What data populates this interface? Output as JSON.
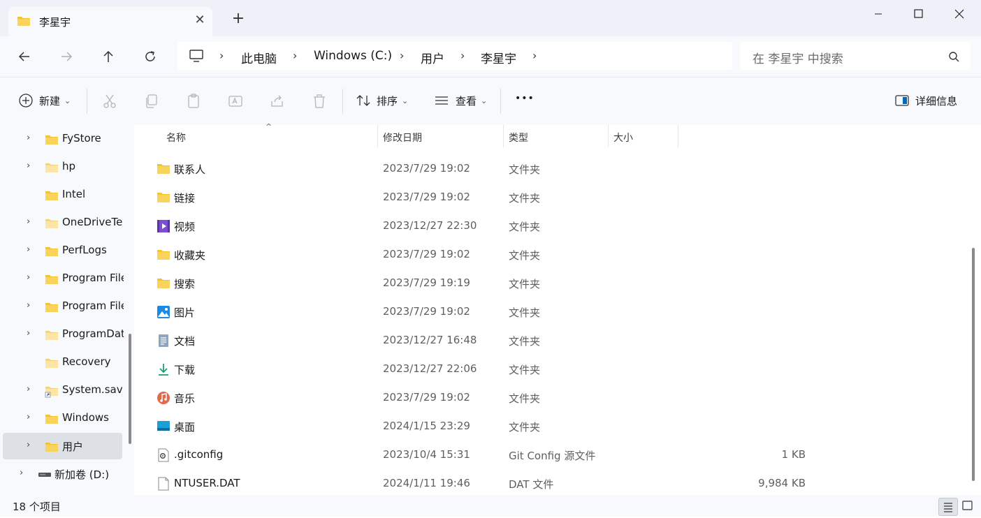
{
  "window": {
    "tab_title": "李星宇",
    "tab_close": "✕",
    "new_tab": "+",
    "minimize": "─",
    "close": "✕"
  },
  "address": {
    "crumbs": [
      "此电脑",
      "Windows (C:)",
      "用户",
      "李星宇"
    ],
    "separator": "›",
    "search_placeholder": "在 李星宇 中搜索"
  },
  "toolbar": {
    "new_label": "新建",
    "sort_label": "排序",
    "view_label": "查看",
    "more_label": "•••",
    "details_label": "详细信息",
    "dropdown_caret": "⌄"
  },
  "sidebar": {
    "items": [
      {
        "label": "FyStore",
        "chevron": "›"
      },
      {
        "label": "hp",
        "chevron": "›"
      },
      {
        "label": "Intel",
        "chevron": ""
      },
      {
        "label": "OneDriveTe",
        "chevron": "›"
      },
      {
        "label": "PerfLogs",
        "chevron": "›"
      },
      {
        "label": "Program File",
        "chevron": "›"
      },
      {
        "label": "Program File",
        "chevron": "›"
      },
      {
        "label": "ProgramDat",
        "chevron": "›"
      },
      {
        "label": "Recovery",
        "chevron": ""
      },
      {
        "label": "System.sav",
        "chevron": "›"
      },
      {
        "label": "Windows",
        "chevron": "›"
      },
      {
        "label": "用户",
        "chevron": "›"
      },
      {
        "label": "新加卷 (D:)",
        "chevron": "›"
      }
    ]
  },
  "table": {
    "sort_indicator": "^",
    "headers": {
      "name": "名称",
      "date": "修改日期",
      "type": "类型",
      "size": "大小"
    },
    "rows": [
      {
        "name": "联系人",
        "date": "2023/7/29 19:02",
        "type": "文件夹",
        "size": "",
        "icon": "folder-icon"
      },
      {
        "name": "链接",
        "date": "2023/7/29 19:02",
        "type": "文件夹",
        "size": "",
        "icon": "folder-icon"
      },
      {
        "name": "视频",
        "date": "2023/12/27 22:30",
        "type": "文件夹",
        "size": "",
        "icon": "videos-folder-icon"
      },
      {
        "name": "收藏夹",
        "date": "2023/7/29 19:02",
        "type": "文件夹",
        "size": "",
        "icon": "folder-icon"
      },
      {
        "name": "搜索",
        "date": "2023/7/29 19:19",
        "type": "文件夹",
        "size": "",
        "icon": "folder-icon"
      },
      {
        "name": "图片",
        "date": "2023/7/29 19:02",
        "type": "文件夹",
        "size": "",
        "icon": "pictures-folder-icon"
      },
      {
        "name": "文档",
        "date": "2023/12/27 16:48",
        "type": "文件夹",
        "size": "",
        "icon": "documents-folder-icon"
      },
      {
        "name": "下载",
        "date": "2023/12/27 22:06",
        "type": "文件夹",
        "size": "",
        "icon": "downloads-folder-icon"
      },
      {
        "name": "音乐",
        "date": "2023/7/29 19:02",
        "type": "文件夹",
        "size": "",
        "icon": "music-folder-icon"
      },
      {
        "name": "桌面",
        "date": "2024/1/15 23:29",
        "type": "文件夹",
        "size": "",
        "icon": "desktop-folder-icon"
      },
      {
        "name": ".gitconfig",
        "date": "2023/10/4 15:31",
        "type": "Git Config 源文件",
        "size": "1 KB",
        "icon": "config-file-icon"
      },
      {
        "name": "NTUSER.DAT",
        "date": "2024/1/11 19:46",
        "type": "DAT 文件",
        "size": "9,984 KB",
        "icon": "file-icon"
      }
    ]
  },
  "status": {
    "item_count": "18 个项目"
  },
  "colors": {
    "folder": "#f4c22b",
    "accent": "#0067c0",
    "chrome": "#f7f9fc",
    "titlebar": "#eef2f8"
  }
}
